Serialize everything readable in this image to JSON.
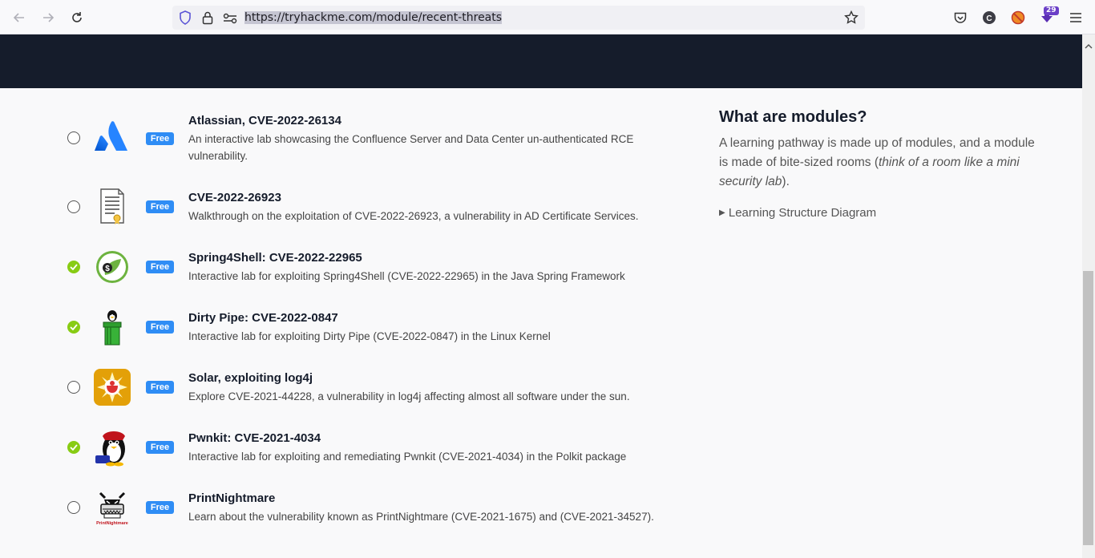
{
  "browser": {
    "url": "https://tryhackme.com/module/recent-threats",
    "extension_badge": "29",
    "icons": [
      "back-icon",
      "forward-icon",
      "reload-icon",
      "shield-icon",
      "lock-icon",
      "permissions-icon",
      "bookmark-star-icon",
      "pocket-icon",
      "profile-c-icon",
      "extension-icon",
      "download-extension-icon",
      "menu-icon"
    ]
  },
  "colors": {
    "banner": "#151c2b",
    "free_badge": "#2f8df5",
    "completed": "#88cc14"
  },
  "rooms": [
    {
      "title": "Atlassian, CVE-2022-26134",
      "desc": "An interactive lab showcasing the Confluence Server and Data Center un-authenticated RCE vulnerability.",
      "badge": "Free",
      "completed": false,
      "logo": "atlassian-logo"
    },
    {
      "title": "CVE-2022-26923",
      "desc": "Walkthrough on the exploitation of CVE-2022-26923, a vulnerability in AD Certificate Services.",
      "badge": "Free",
      "completed": false,
      "logo": "certificate-logo"
    },
    {
      "title": "Spring4Shell: CVE-2022-22965",
      "desc": "Interactive lab for exploiting Spring4Shell (CVE-2022-22965) in the Java Spring Framework",
      "badge": "Free",
      "completed": true,
      "logo": "spring-logo"
    },
    {
      "title": "Dirty Pipe: CVE-2022-0847",
      "desc": "Interactive lab for exploiting Dirty Pipe (CVE-2022-0847) in the Linux Kernel",
      "badge": "Free",
      "completed": true,
      "logo": "tux-pipe-logo"
    },
    {
      "title": "Solar, exploiting log4j",
      "desc": "Explore CVE-2021-44228, a vulnerability in log4j affecting almost all software under the sun.",
      "badge": "Free",
      "completed": false,
      "logo": "sun-log4j-logo"
    },
    {
      "title": "Pwnkit: CVE-2021-4034",
      "desc": "Interactive lab for exploiting and remediating Pwnkit (CVE-2021-4034) in the Polkit package",
      "badge": "Free",
      "completed": true,
      "logo": "pwnkit-tux-logo"
    },
    {
      "title": "PrintNightmare",
      "desc": "Learn about the vulnerability known as PrintNightmare (CVE-2021-1675) and (CVE-2021-34527).",
      "badge": "Free",
      "completed": false,
      "logo": "printnightmare-logo",
      "logo_text": "PrintNightmare"
    }
  ],
  "sidebar": {
    "title": "What are modules?",
    "text_before": "A learning pathway is made up of modules, and a module is made of bite-sized rooms (",
    "text_italic": "think of a room like a mini security lab",
    "text_after": ").",
    "details_label": "Learning Structure Diagram"
  }
}
